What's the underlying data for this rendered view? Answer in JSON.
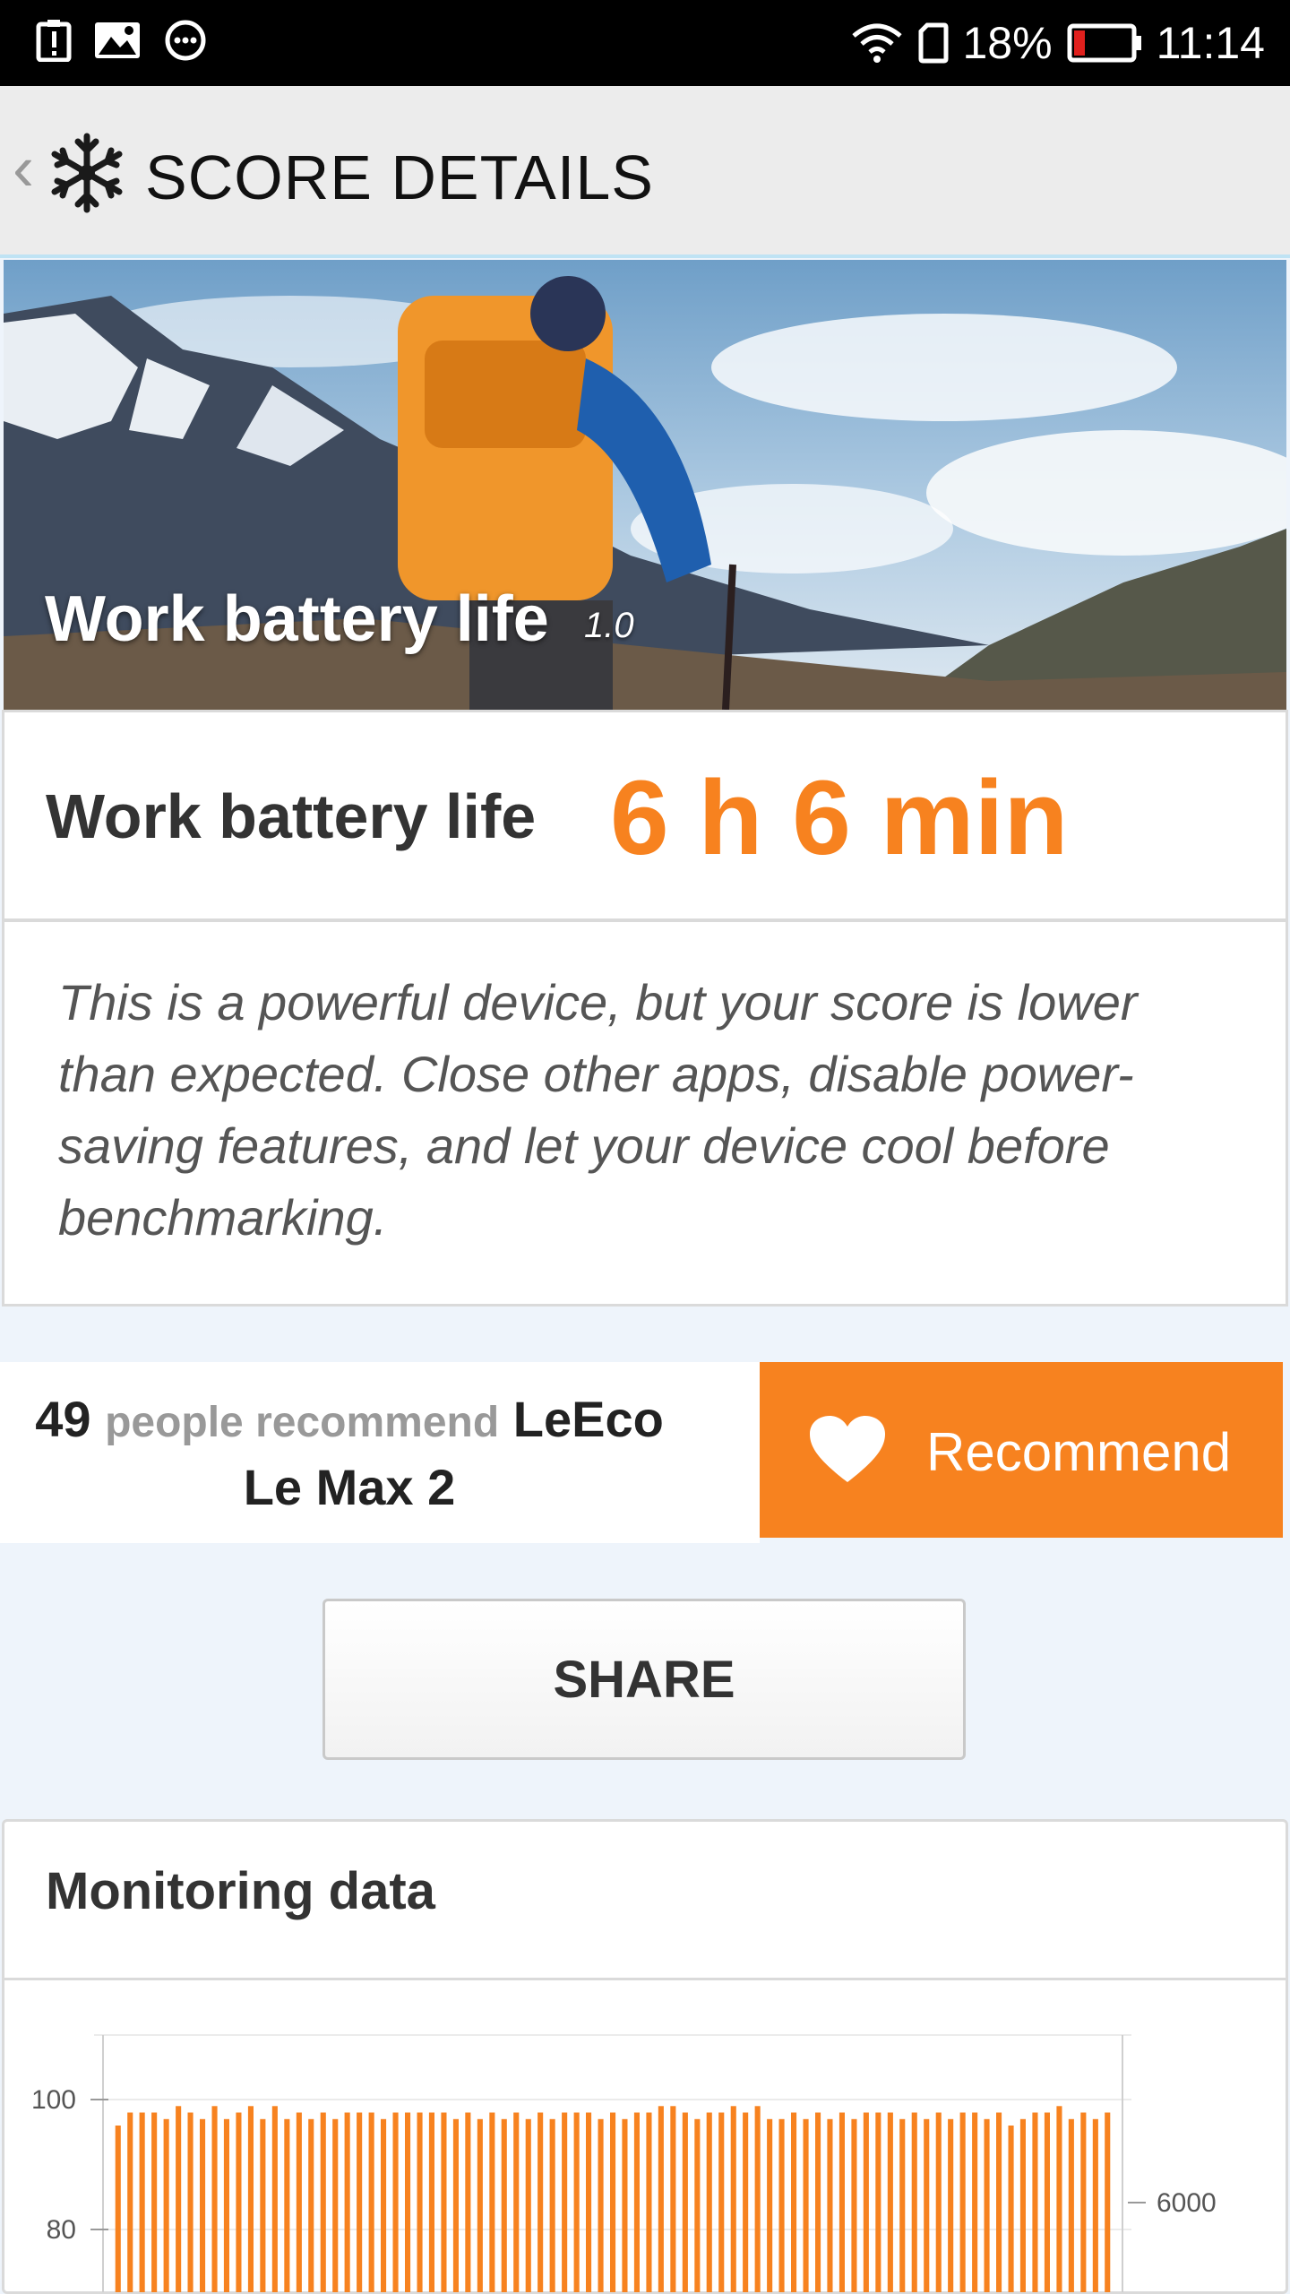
{
  "status_bar": {
    "battery_percent": "18%",
    "time": "11:14",
    "left_icons": [
      "alert-icon",
      "image-icon",
      "chat-icon"
    ],
    "right_icons": [
      "wifi-icon",
      "sim-icon",
      "battery-icon"
    ]
  },
  "header": {
    "title": "SCORE DETAILS"
  },
  "hero": {
    "title": "Work battery life",
    "version": "1.0"
  },
  "score": {
    "label": "Work battery life",
    "value": "6 h 6 min",
    "value_color": "#f7821f"
  },
  "description": "This is a powerful device, but your score is lower than expected. Close other apps, disable power-saving features, and let your device cool before benchmarking.",
  "recommend": {
    "count": "49",
    "text": "people recommend",
    "device": "LeEco Le Max 2",
    "button_label": "Recommend"
  },
  "share": {
    "label": "SHARE"
  },
  "monitoring": {
    "title": "Monitoring data",
    "chart_data": {
      "type": "bar",
      "bar_color": "#f7821f",
      "y_left_ticks": [
        "100",
        "80"
      ],
      "y_right_ticks": [
        "6000"
      ],
      "values": [
        96,
        98,
        98,
        98,
        97,
        99,
        98,
        97,
        99,
        97,
        98,
        99,
        97,
        99,
        97,
        98,
        97,
        98,
        97,
        98,
        98,
        98,
        97,
        98,
        98,
        98,
        98,
        98,
        97,
        98,
        97,
        98,
        97,
        98,
        97,
        98,
        97,
        98,
        98,
        98,
        97,
        98,
        97,
        98,
        98,
        99,
        99,
        98,
        97,
        98,
        98,
        99,
        98,
        99,
        97,
        97,
        98,
        97,
        98,
        97,
        98,
        97,
        98,
        98,
        98,
        97,
        98,
        97,
        98,
        97,
        98,
        98,
        97,
        98,
        96,
        97,
        98,
        98,
        99,
        97,
        98,
        97,
        98
      ],
      "grid": true
    }
  }
}
